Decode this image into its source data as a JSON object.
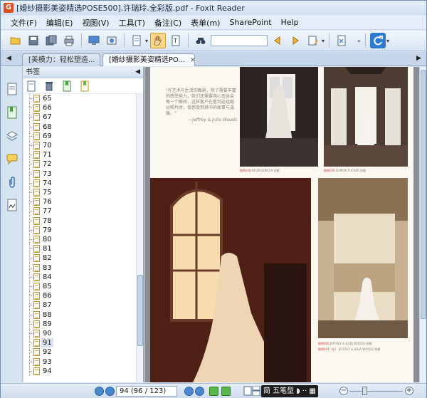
{
  "window": {
    "title": "[婚纱摄影美姿精选POSE500].许瑞玲.全彩版.pdf - Foxit Reader"
  },
  "menu": [
    "文件(F)",
    "编辑(E)",
    "视图(V)",
    "工具(T)",
    "备注(C)",
    "表单(m)",
    "SharePoint",
    "Help"
  ],
  "tabs": [
    {
      "label": "[美模力：轻松塑造...",
      "active": false
    },
    {
      "label": "[婚纱摄影美姿精选PO...",
      "active": true
    }
  ],
  "bookmarks": {
    "header": "书签",
    "items": [
      "65",
      "66",
      "67",
      "68",
      "69",
      "70",
      "71",
      "72",
      "73",
      "74",
      "75",
      "76",
      "77",
      "78",
      "79",
      "80",
      "81",
      "82",
      "83",
      "84",
      "85",
      "86",
      "87",
      "88",
      "89",
      "90",
      "91",
      "92",
      "93",
      "94"
    ],
    "selected": "91"
  },
  "document": {
    "quote": "\"在艺术与生活的图景，除了需要丰富的感受能力，我们还需要用心去体会每一个瞬间，这样客户在看到这组婚纱照片时，会感受到其中的故事与温暖。\"",
    "quote_author": "—Jeffrey & Julia Woods",
    "captions": [
      {
        "num": "图例038",
        "credit": "KEVIN KUBOTA 拍摄"
      },
      {
        "num": "图例039",
        "credit": "DAMON TUCKER 拍摄"
      },
      {
        "num": "图例040",
        "credit": "JEFFREY & JULIA WOODS 拍摄"
      },
      {
        "num": "图例041（左）",
        "credit": "JEFFREY & JULIA WOODS 拍摄"
      }
    ]
  },
  "status": {
    "page_indicator": "94 (96 / 123)",
    "ime": "简 五笔型 ◗ ·· ▦"
  },
  "colors": {
    "accent": "#4b86d1",
    "active_tool": "#f6d887"
  }
}
